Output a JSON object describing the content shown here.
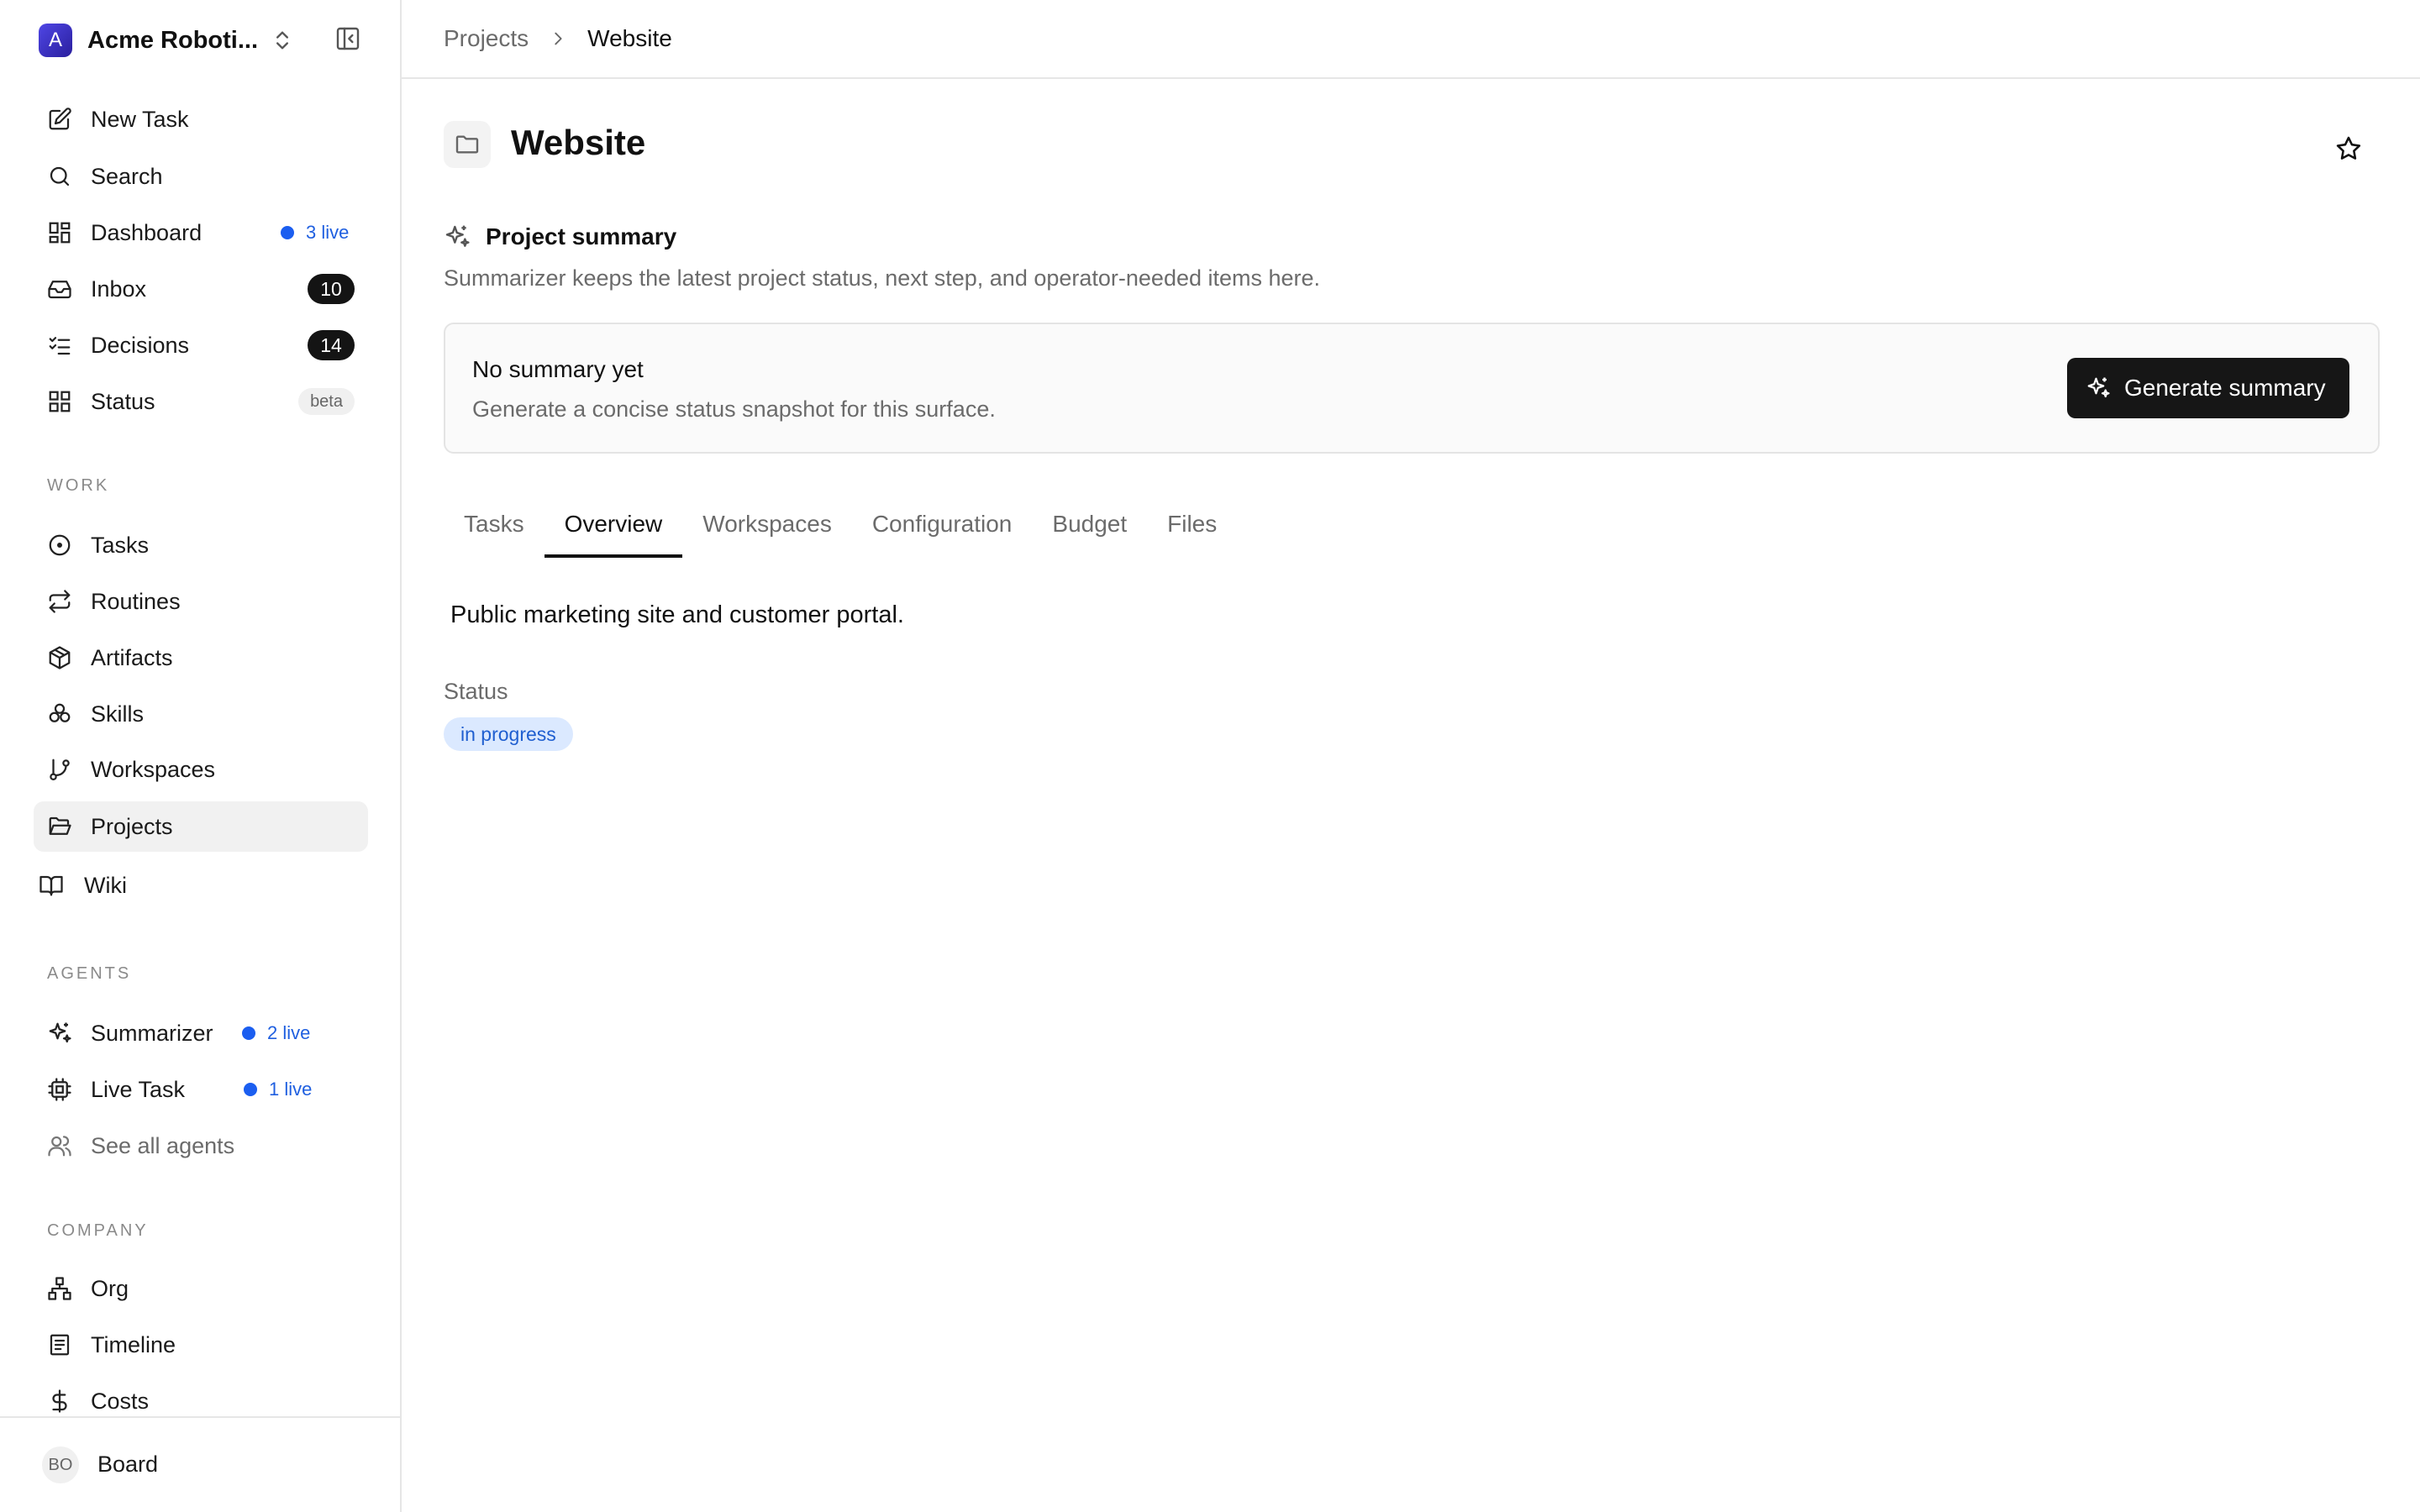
{
  "org": {
    "name": "Acme Roboti...",
    "avatar_letter": "A"
  },
  "nav": {
    "new_task": "New Task",
    "search": "Search",
    "dashboard": {
      "label": "Dashboard",
      "live": "3 live"
    },
    "inbox": {
      "label": "Inbox",
      "count": "10"
    },
    "decisions": {
      "label": "Decisions",
      "count": "14"
    },
    "status": {
      "label": "Status",
      "badge": "beta"
    }
  },
  "sections": {
    "work": {
      "label": "WORK",
      "items": [
        "Tasks",
        "Routines",
        "Artifacts",
        "Skills",
        "Workspaces",
        "Projects",
        "Wiki"
      ]
    },
    "agents": {
      "label": "AGENTS",
      "summarizer": {
        "label": "Summarizer",
        "live": "2 live"
      },
      "live_task": {
        "label": "Live Task",
        "live": "1 live"
      },
      "see_all": "See all agents"
    },
    "company": {
      "label": "COMPANY",
      "items": [
        "Org",
        "Timeline",
        "Costs"
      ]
    }
  },
  "user": {
    "initials": "BO",
    "name": "Board"
  },
  "breadcrumb": {
    "parent": "Projects",
    "current": "Website"
  },
  "page": {
    "title": "Website"
  },
  "summary": {
    "title": "Project summary",
    "description": "Summarizer keeps the latest project status, next step, and operator-needed items here.",
    "card_title": "No summary yet",
    "card_description": "Generate a concise status snapshot for this surface.",
    "button_label": "Generate summary"
  },
  "tabs": [
    "Tasks",
    "Overview",
    "Workspaces",
    "Configuration",
    "Budget",
    "Files"
  ],
  "active_tab": "Overview",
  "overview": {
    "description": "Public marketing site and customer portal.",
    "status_label": "Status",
    "status_value": "in progress"
  },
  "colors": {
    "accent_live": "#1b5ef0",
    "status_pill_bg": "#dbe9ff",
    "status_pill_text": "#1f5fd0",
    "primary_button": "#161616"
  }
}
